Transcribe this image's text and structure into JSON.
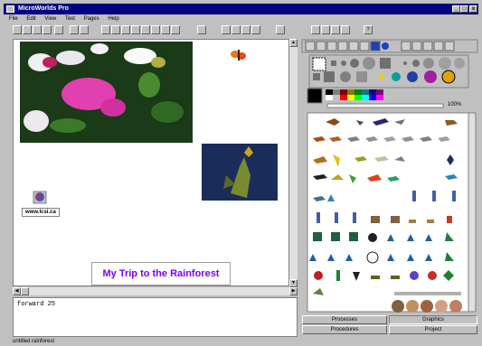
{
  "window": {
    "title": "MicroWorlds Pro",
    "min": "_",
    "max": "□",
    "close": "x"
  },
  "menu": [
    "File",
    "Edit",
    "View",
    "Text",
    "Pages",
    "Help"
  ],
  "page": {
    "link_label": "www.lcsi.ca",
    "title_box_text": "My Trip to the Rainforest",
    "title_color": "#7a00ff"
  },
  "command_center": {
    "text": "forward 25"
  },
  "status": {
    "text": "untitled  rainforest"
  },
  "palette": {
    "percent_label": "100%"
  },
  "tabs": {
    "processes": "Processes",
    "graphics": "Graphics",
    "procedures": "Procedures",
    "project": "Project"
  },
  "colors": {
    "titlebar": "#000080",
    "title_text": "#7a00ff"
  }
}
